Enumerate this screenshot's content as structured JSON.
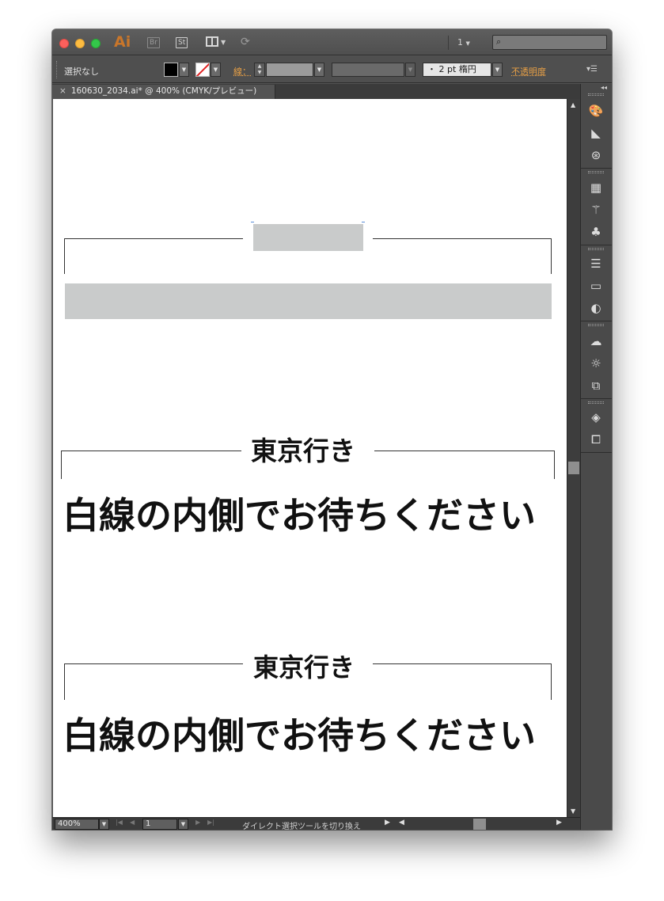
{
  "titlebar": {
    "app_logo": "Ai",
    "bridge_label": "Br",
    "stock_label": "St",
    "workspace_number": "1",
    "icons": [
      "close-button",
      "minimize-button",
      "zoom-button",
      "layout-icon",
      "sync-icon",
      "search-icon"
    ]
  },
  "controlbar": {
    "selection_label": "選択なし",
    "stroke_label": "線",
    "stroke_style": "・ 2 pt 楕円",
    "opacity_label": "不透明度",
    "fill_color": "#000000",
    "stroke_color": "none"
  },
  "tab": {
    "title": "160630_2034.ai* @ 400% (CMYK/プレビュー)"
  },
  "artwork": {
    "sign1": {
      "title": "東京行き",
      "main": "白線の内側でお待ちください"
    },
    "sign2": {
      "title": "東京行き",
      "main": "白線の内側でお待ちください"
    },
    "placeholder_color": "#c9cbcb"
  },
  "statusbar": {
    "zoom": "400%",
    "page": "1",
    "status": "ダイレクト選択ツールを切り換え"
  },
  "colors": {
    "accent_orange": "#e8a046",
    "ui_dark": "#535353"
  }
}
